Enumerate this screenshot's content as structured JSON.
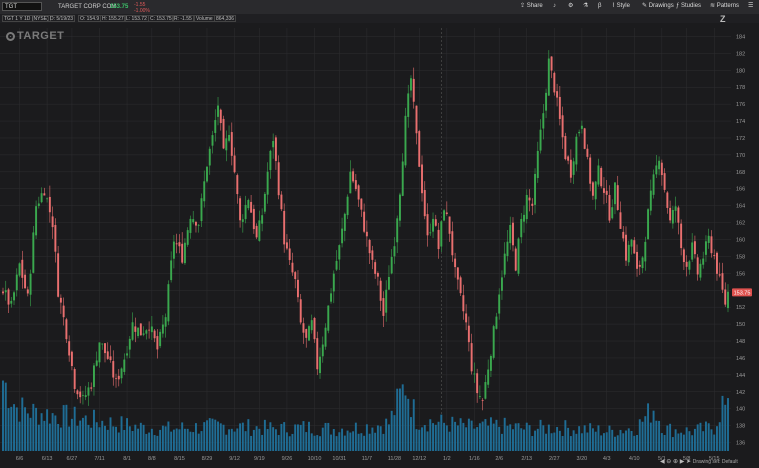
{
  "toolbar": {
    "symbol": "TGT",
    "company": "TARGET CORP COM",
    "last": "153.75",
    "chg": "-1.55",
    "chg_pct": "-1.00%",
    "share": "Share",
    "style": "Style",
    "drawings": "Drawings",
    "studies": "Studies",
    "patterns": "Patterns"
  },
  "info": {
    "label": "TGT 1 Y 1D (NYSE)",
    "date": "D: 5/19/23",
    "open": "O: 154.9",
    "high": "H: 155.27",
    "low": "L: 153.72",
    "close": "C: 153.75",
    "chg": "R: -1.55",
    "volume_label": "Volume",
    "volume": "864,336"
  },
  "logo": "TARGET",
  "colors": {
    "up": "#3aa84e",
    "down": "#e96f6f",
    "volume": "#1f6d95",
    "price_tag": "#e0524f",
    "grid": "#2e2e31",
    "background": "#1b1b1d"
  },
  "status": {
    "drawing_set": "Drawing set: Default"
  },
  "chart_data": {
    "type": "candlestick",
    "title": "TGT 1 Y 1D (NYSE)",
    "yticks": [
      136,
      138,
      140,
      142,
      144,
      146,
      148,
      150,
      152,
      154,
      156,
      158,
      160,
      162,
      164,
      166,
      168,
      170,
      172,
      174,
      176,
      178,
      180,
      182,
      184
    ],
    "ylim": [
      135,
      185
    ],
    "xticks": [
      "6/6",
      "6/13",
      "6/27",
      "7/11",
      "8/1",
      "8/8",
      "8/15",
      "8/29",
      "9/12",
      "9/19",
      "9/26",
      "10/10",
      "10/31",
      "11/7",
      "11/28",
      "12/12",
      "1/2",
      "1/16",
      "2/6",
      "2/13",
      "2/27",
      "3/20",
      "4/3",
      "4/10",
      "5/1",
      "5/8",
      "5/15"
    ],
    "last_price": 153.75,
    "price_path": [
      [
        0,
        154
      ],
      [
        3,
        152
      ],
      [
        6,
        157
      ],
      [
        9,
        153
      ],
      [
        12,
        164
      ],
      [
        15,
        166
      ],
      [
        18,
        162
      ],
      [
        20,
        154
      ],
      [
        23,
        149
      ],
      [
        26,
        143
      ],
      [
        29,
        141
      ],
      [
        32,
        143
      ],
      [
        35,
        148
      ],
      [
        38,
        146
      ],
      [
        41,
        143
      ],
      [
        44,
        146
      ],
      [
        47,
        150
      ],
      [
        50,
        149
      ],
      [
        53,
        150
      ],
      [
        56,
        147
      ],
      [
        59,
        151
      ],
      [
        62,
        160
      ],
      [
        65,
        158
      ],
      [
        68,
        163
      ],
      [
        71,
        162
      ],
      [
        74,
        169
      ],
      [
        76,
        172
      ],
      [
        78,
        176
      ],
      [
        80,
        170
      ],
      [
        82,
        173
      ],
      [
        84,
        168
      ],
      [
        86,
        162
      ],
      [
        89,
        165
      ],
      [
        92,
        160
      ],
      [
        94,
        163
      ],
      [
        96,
        168
      ],
      [
        98,
        172
      ],
      [
        100,
        166
      ],
      [
        102,
        160
      ],
      [
        104,
        157
      ],
      [
        106,
        155
      ],
      [
        108,
        150
      ],
      [
        110,
        148
      ],
      [
        112,
        150
      ],
      [
        114,
        145
      ],
      [
        116,
        148
      ],
      [
        118,
        152
      ],
      [
        120,
        156
      ],
      [
        122,
        159
      ],
      [
        124,
        163
      ],
      [
        126,
        168
      ],
      [
        128,
        166
      ],
      [
        130,
        163
      ],
      [
        132,
        160
      ],
      [
        134,
        157
      ],
      [
        136,
        155
      ],
      [
        138,
        151
      ],
      [
        140,
        156
      ],
      [
        142,
        160
      ],
      [
        144,
        166
      ],
      [
        146,
        174
      ],
      [
        148,
        179
      ],
      [
        150,
        172
      ],
      [
        152,
        166
      ],
      [
        154,
        160
      ],
      [
        156,
        163
      ],
      [
        158,
        159
      ],
      [
        160,
        164
      ],
      [
        162,
        161
      ],
      [
        164,
        156
      ],
      [
        166,
        153
      ],
      [
        168,
        150
      ],
      [
        170,
        145
      ],
      [
        172,
        142
      ],
      [
        174,
        141
      ],
      [
        176,
        145
      ],
      [
        178,
        149
      ],
      [
        180,
        154
      ],
      [
        182,
        158
      ],
      [
        184,
        161
      ],
      [
        186,
        157
      ],
      [
        188,
        162
      ],
      [
        190,
        165
      ],
      [
        192,
        164
      ],
      [
        194,
        170
      ],
      [
        196,
        175
      ],
      [
        198,
        181
      ],
      [
        200,
        178
      ],
      [
        202,
        174
      ],
      [
        204,
        170
      ],
      [
        206,
        168
      ],
      [
        208,
        172
      ],
      [
        210,
        174
      ],
      [
        212,
        169
      ],
      [
        214,
        165
      ],
      [
        216,
        168
      ],
      [
        218,
        166
      ],
      [
        220,
        163
      ],
      [
        222,
        166
      ],
      [
        224,
        162
      ],
      [
        226,
        158
      ],
      [
        228,
        160
      ],
      [
        230,
        156
      ],
      [
        232,
        158
      ],
      [
        234,
        163
      ],
      [
        236,
        167
      ],
      [
        238,
        170
      ],
      [
        240,
        166
      ],
      [
        242,
        162
      ],
      [
        244,
        164
      ],
      [
        246,
        159
      ],
      [
        248,
        157
      ],
      [
        250,
        159
      ],
      [
        252,
        156
      ],
      [
        254,
        158
      ],
      [
        256,
        160
      ],
      [
        258,
        158
      ],
      [
        260,
        155
      ],
      [
        262,
        152.5
      ],
      [
        263,
        153.75
      ]
    ],
    "volume_path": [
      [
        0,
        0.9
      ],
      [
        5,
        0.55
      ],
      [
        10,
        0.5
      ],
      [
        20,
        0.45
      ],
      [
        30,
        0.4
      ],
      [
        40,
        0.35
      ],
      [
        50,
        0.3
      ],
      [
        60,
        0.28
      ],
      [
        70,
        0.3
      ],
      [
        80,
        0.32
      ],
      [
        90,
        0.3
      ],
      [
        100,
        0.28
      ],
      [
        110,
        0.3
      ],
      [
        120,
        0.28
      ],
      [
        130,
        0.3
      ],
      [
        140,
        0.35
      ],
      [
        146,
        0.85
      ],
      [
        150,
        0.4
      ],
      [
        160,
        0.35
      ],
      [
        170,
        0.3
      ],
      [
        180,
        0.32
      ],
      [
        190,
        0.28
      ],
      [
        200,
        0.3
      ],
      [
        210,
        0.28
      ],
      [
        220,
        0.25
      ],
      [
        230,
        0.3
      ],
      [
        236,
        0.55
      ],
      [
        240,
        0.28
      ],
      [
        250,
        0.25
      ],
      [
        258,
        0.3
      ],
      [
        261,
        0.6
      ],
      [
        263,
        0.5
      ]
    ]
  }
}
